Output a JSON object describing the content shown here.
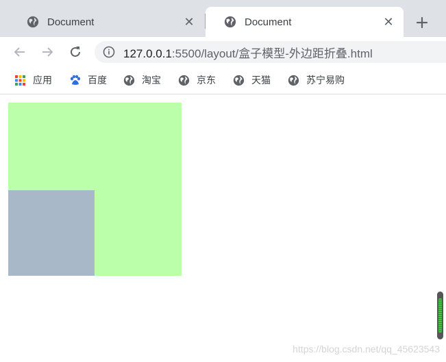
{
  "tabs": [
    {
      "title": "Document",
      "active": false
    },
    {
      "title": "Document",
      "active": true
    }
  ],
  "address_bar": {
    "url_host": "127.0.0.1",
    "url_path": ":5500/layout/盒子模型-外边距折叠.html"
  },
  "bookmarks": [
    {
      "label": "应用",
      "icon": "apps-grid-icon"
    },
    {
      "label": "百度",
      "icon": "baidu-paw-icon"
    },
    {
      "label": "淘宝",
      "icon": "globe-icon"
    },
    {
      "label": "京东",
      "icon": "globe-icon"
    },
    {
      "label": "天猫",
      "icon": "globe-icon"
    },
    {
      "label": "苏宁易购",
      "icon": "globe-icon"
    }
  ],
  "page": {
    "outer_box_color": "#bbffaa",
    "inner_box_color": "#a8b8c8"
  },
  "watermark": "https://blog.csdn.net/qq_45623543"
}
